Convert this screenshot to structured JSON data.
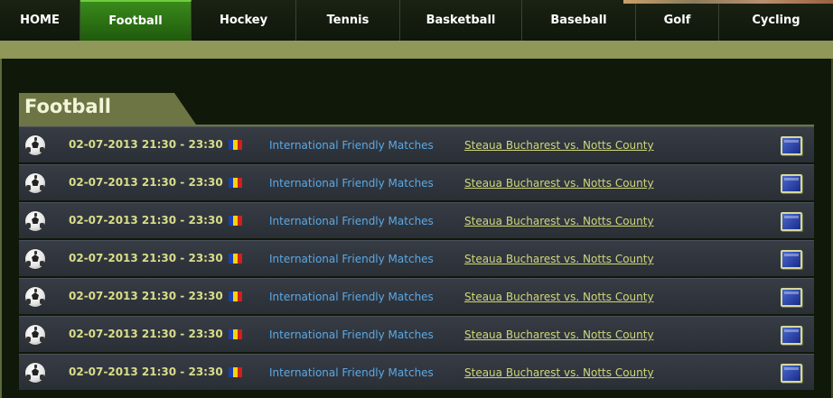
{
  "nav": {
    "items": [
      {
        "label": "HOME"
      },
      {
        "label": "Football"
      },
      {
        "label": "Hockey"
      },
      {
        "label": "Tennis"
      },
      {
        "label": "Basketball"
      },
      {
        "label": "Baseball"
      },
      {
        "label": "Golf"
      },
      {
        "label": "Cycling"
      }
    ],
    "active": "Football"
  },
  "section": {
    "title": "Football"
  },
  "flag_colors": [
    "#1a3fb0",
    "#f5d20a",
    "#d01f1f"
  ],
  "rows": [
    {
      "datetime": "02-07-2013 21:30 - 23:30",
      "league": "International Friendly Matches",
      "match": "Steaua Bucharest vs. Notts County",
      "sport_icon": "soccer-ball-icon",
      "flag_icon": "romania-flag-icon",
      "watch_icon": "tv-icon"
    },
    {
      "datetime": "02-07-2013 21:30 - 23:30",
      "league": "International Friendly Matches",
      "match": "Steaua Bucharest vs. Notts County",
      "sport_icon": "soccer-ball-icon",
      "flag_icon": "romania-flag-icon",
      "watch_icon": "tv-icon"
    },
    {
      "datetime": "02-07-2013 21:30 - 23:30",
      "league": "International Friendly Matches",
      "match": "Steaua Bucharest vs. Notts County",
      "sport_icon": "soccer-ball-icon",
      "flag_icon": "romania-flag-icon",
      "watch_icon": "tv-icon"
    },
    {
      "datetime": "02-07-2013 21:30 - 23:30",
      "league": "International Friendly Matches",
      "match": "Steaua Bucharest vs. Notts County",
      "sport_icon": "soccer-ball-icon",
      "flag_icon": "romania-flag-icon",
      "watch_icon": "tv-icon"
    },
    {
      "datetime": "02-07-2013 21:30 - 23:30",
      "league": "International Friendly Matches",
      "match": "Steaua Bucharest vs. Notts County",
      "sport_icon": "soccer-ball-icon",
      "flag_icon": "romania-flag-icon",
      "watch_icon": "tv-icon"
    },
    {
      "datetime": "02-07-2013 21:30 - 23:30",
      "league": "International Friendly Matches",
      "match": "Steaua Bucharest vs. Notts County",
      "sport_icon": "soccer-ball-icon",
      "flag_icon": "romania-flag-icon",
      "watch_icon": "tv-icon"
    },
    {
      "datetime": "02-07-2013 21:30 - 23:30",
      "league": "International Friendly Matches",
      "match": "Steaua Bucharest vs. Notts County",
      "sport_icon": "soccer-ball-icon",
      "flag_icon": "romania-flag-icon",
      "watch_icon": "tv-icon"
    }
  ]
}
